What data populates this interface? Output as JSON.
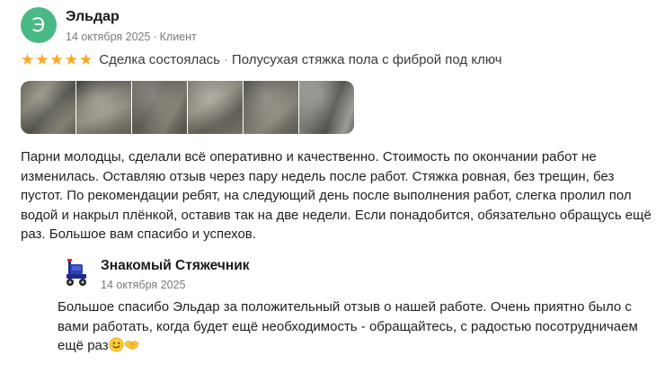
{
  "review": {
    "avatar_letter": "Э",
    "avatar_color": "#49b985",
    "author": "Эльдар",
    "date": "14 октября 2025",
    "role": "Клиент",
    "rating": 5,
    "rating_max": 5,
    "star_color": "#ffa51f",
    "deal_status": "Сделка состоялась",
    "service": "Полусухая стяжка пола с фиброй под ключ",
    "photos_count": 6,
    "text": "Парни молодцы, сделали всё оперативно и качественно. Стоимость по окончании работ не изменилась. Оставляю отзыв через пару недель после работ. Стяжка ровная, без трещин, без пустот. По рекомендации ребят, на следующий день после выполнения работ, слегка пролил пол водой и накрыл плёнкой, оставив так на две недели. Если понадобится, обязательно обращусь ещё раз. Большое вам спасибо и успехов."
  },
  "reply": {
    "author": "Знакомый Стяжечник",
    "date": "14 октября 2025",
    "text": "Большое спасибо Эльдар за положительный отзыв о нашей работе. Очень приятно было с вами работать, когда будет ещё необходимость - обращайтесь, с радостью посотрудничаем ещё раз",
    "emojis": [
      "smiling-face-emoji",
      "handshake-emoji"
    ]
  }
}
